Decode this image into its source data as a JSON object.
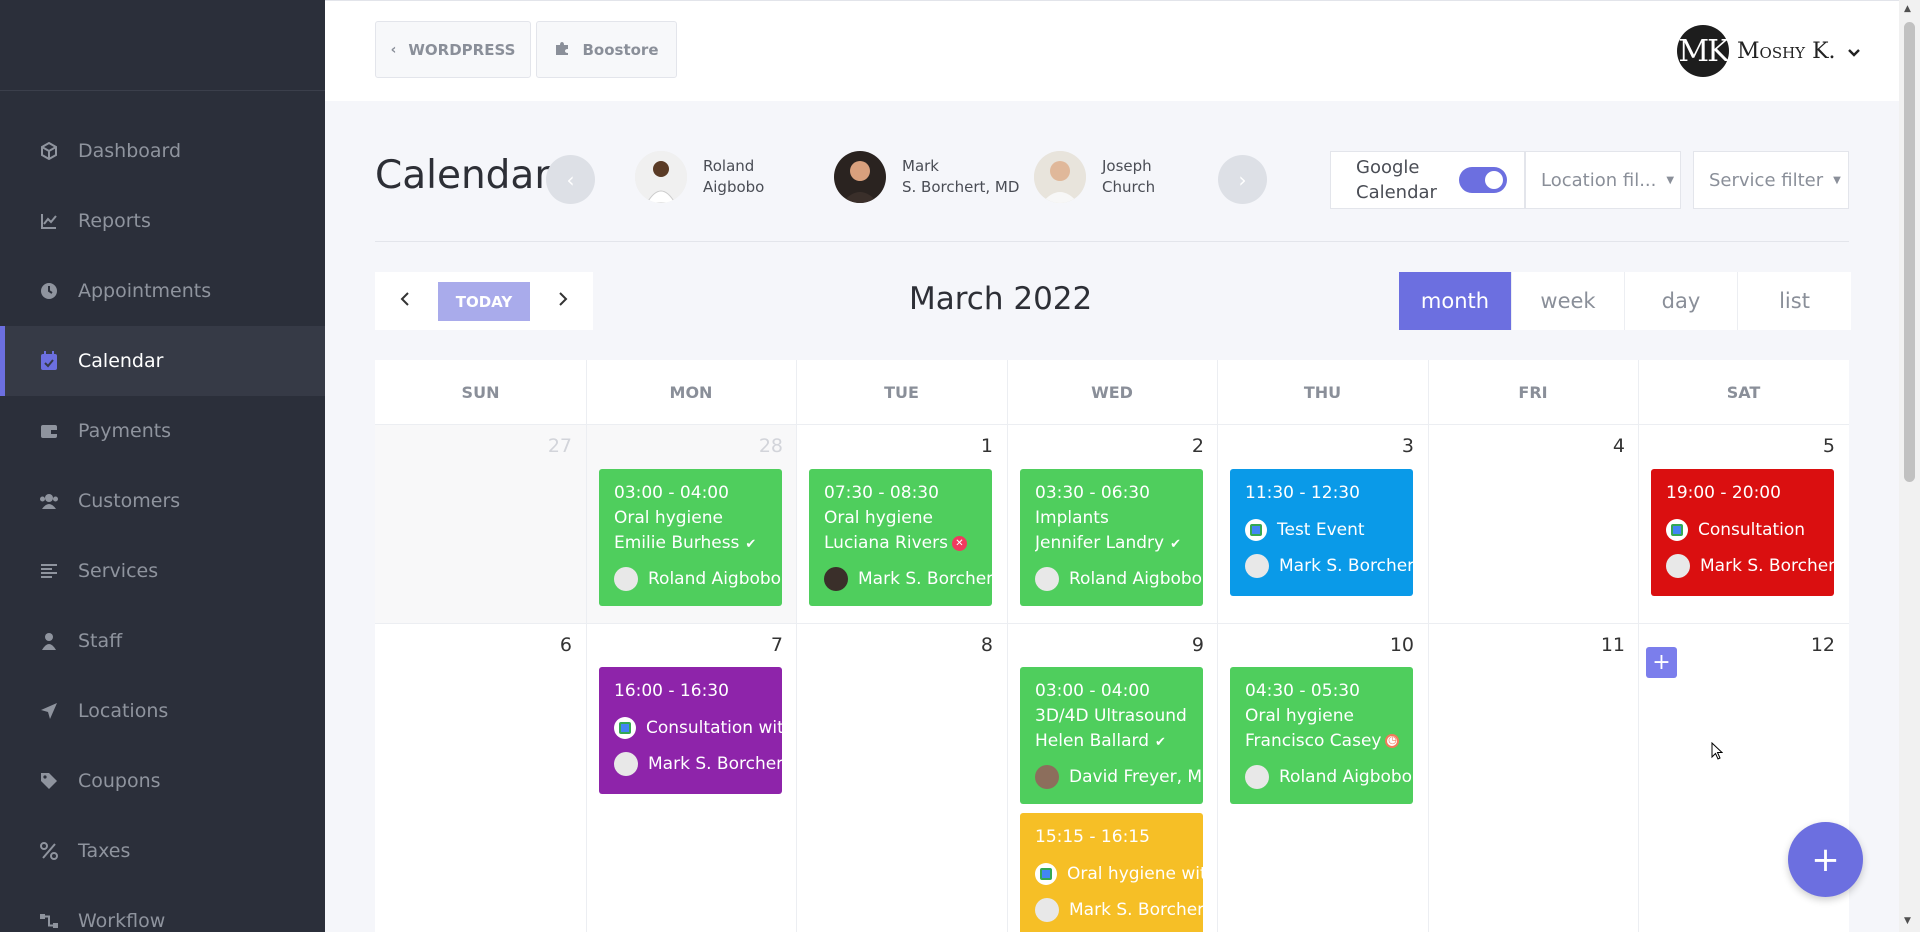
{
  "sidebar": {
    "items": [
      {
        "label": "Dashboard",
        "icon": "cube-icon"
      },
      {
        "label": "Reports",
        "icon": "chart-icon"
      },
      {
        "label": "Appointments",
        "icon": "clock-icon"
      },
      {
        "label": "Calendar",
        "icon": "calendar-check-icon",
        "active": true
      },
      {
        "label": "Payments",
        "icon": "wallet-icon"
      },
      {
        "label": "Customers",
        "icon": "users-icon"
      },
      {
        "label": "Services",
        "icon": "list-icon"
      },
      {
        "label": "Staff",
        "icon": "user-icon"
      },
      {
        "label": "Locations",
        "icon": "location-arrow-icon"
      },
      {
        "label": "Coupons",
        "icon": "tag-icon"
      },
      {
        "label": "Taxes",
        "icon": "percent-icon"
      },
      {
        "label": "Workflow",
        "icon": "workflow-icon"
      }
    ]
  },
  "topbar": {
    "back_label": "WORDPRESS",
    "store_label": "Boostore",
    "user_initials": "MK",
    "user_name": "Moshy K."
  },
  "header": {
    "title": "Calendar",
    "staff": [
      {
        "line1": "Roland",
        "line2": "Aigbobo"
      },
      {
        "line1": "Mark",
        "line2": "S. Borchert, MD"
      },
      {
        "line1": "Joseph",
        "line2": "Church"
      }
    ],
    "google_calendar_label": "Google Calendar",
    "google_calendar_on": true,
    "location_filter": "Location fil...",
    "service_filter": "Service filter"
  },
  "toolbar": {
    "today_label": "TODAY",
    "month_title": "March 2022",
    "views": [
      "month",
      "week",
      "day",
      "list"
    ],
    "active_view": "month"
  },
  "calendar": {
    "weekdays": [
      "SUN",
      "MON",
      "TUE",
      "WED",
      "THU",
      "FRI",
      "SAT"
    ],
    "week1": [
      "27",
      "28",
      "1",
      "2",
      "3",
      "4",
      "5"
    ],
    "week2": [
      "6",
      "7",
      "8",
      "9",
      "10",
      "11",
      "12"
    ],
    "events": [
      {
        "time": "03:00 - 04:00",
        "service": "Oral hygiene",
        "customer": "Emilie Burhess",
        "staff": "Roland Aigbobo",
        "color": "#4fce5d",
        "status": "approved"
      },
      {
        "time": "07:30 - 08:30",
        "service": "Oral hygiene",
        "customer": "Luciana Rivers",
        "staff": "Mark S. Borchert",
        "color": "#4fce5d",
        "status": "canceled"
      },
      {
        "time": "03:30 - 06:30",
        "service": "Implants",
        "customer": "Jennifer Landry",
        "staff": "Roland Aigbobo",
        "color": "#4fce5d",
        "status": "approved"
      },
      {
        "time": "11:30 - 12:30",
        "title": "Test Event",
        "staff": "Mark S. Borchert",
        "color": "#0a9ae8"
      },
      {
        "time": "19:00 - 20:00",
        "title": "Consultation",
        "staff": "Mark S. Borchert",
        "color": "#da0f10"
      },
      {
        "time": "16:00 - 16:30",
        "title": "Consultation with",
        "staff": "Mark S. Borchert",
        "color": "#8e24aa"
      },
      {
        "time": "03:00 - 04:00",
        "service": "3D/4D Ultrasound",
        "customer": "Helen Ballard",
        "staff": "David Freyer, MD",
        "color": "#4fce5d",
        "status": "approved"
      },
      {
        "time": "15:15 - 16:15",
        "title": "Oral hygiene with",
        "staff": "Mark S. Borchert",
        "color": "#f6bf26"
      },
      {
        "time": "04:30 - 05:30",
        "service": "Oral hygiene",
        "customer": "Francisco Casey",
        "staff": "Roland Aigbobo",
        "color": "#4fce5d",
        "status": "pending"
      }
    ]
  },
  "colors": {
    "accent": "#6c6fe0",
    "sidebar_bg": "#2b2f3a"
  }
}
